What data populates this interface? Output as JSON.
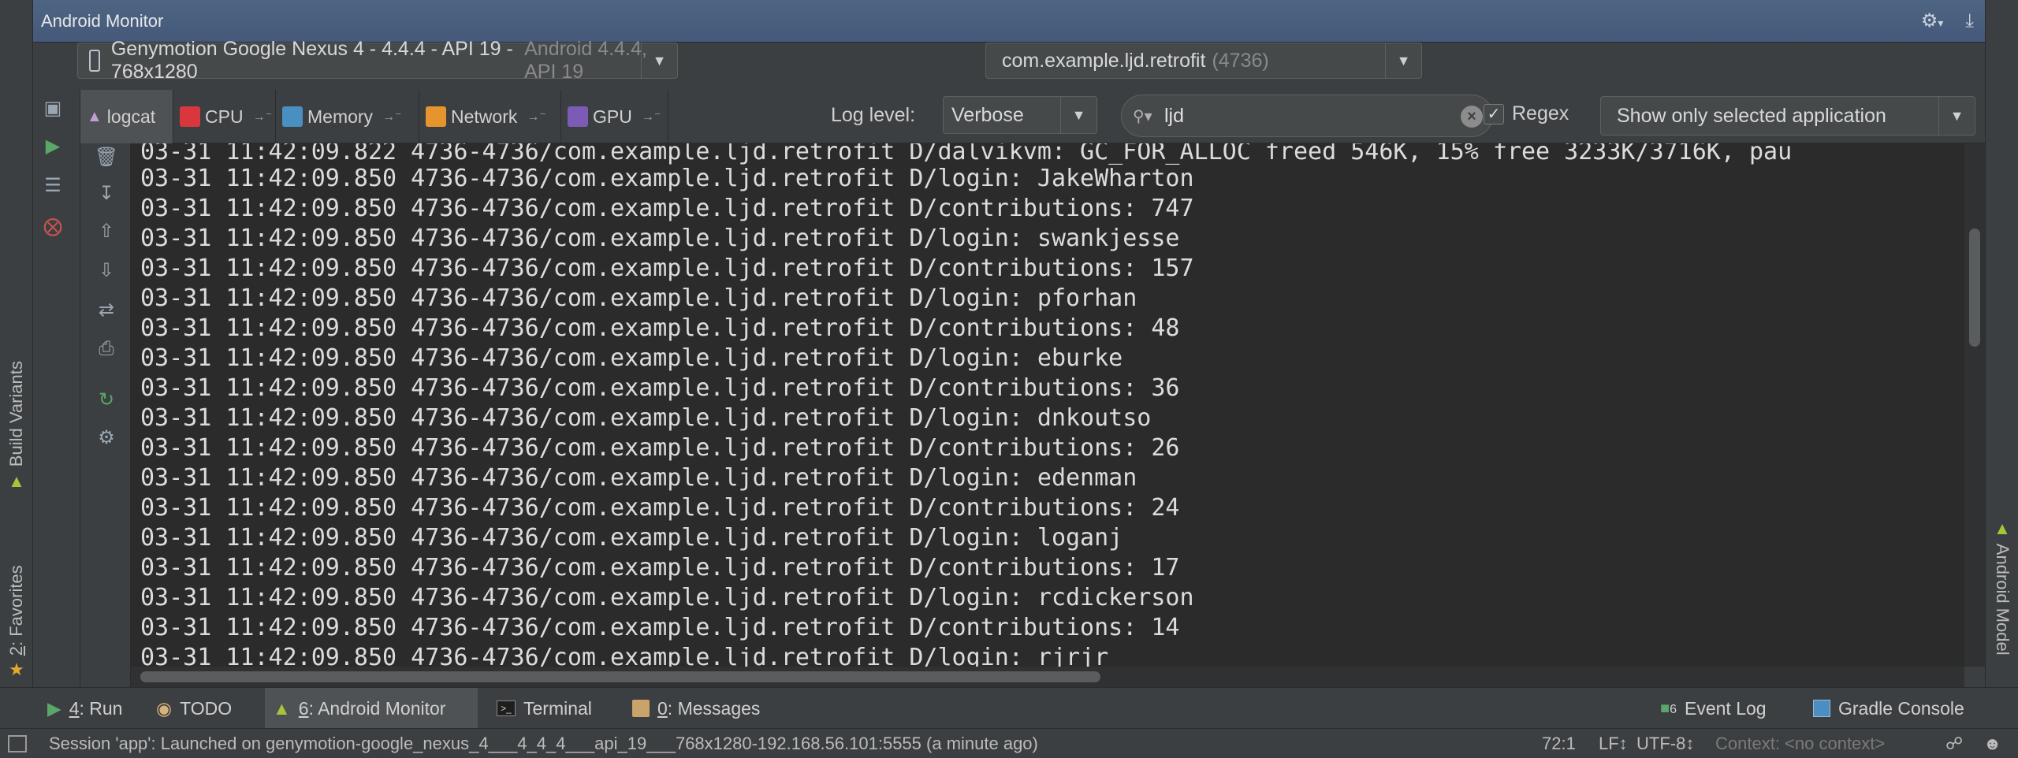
{
  "window": {
    "title": "Android Monitor"
  },
  "side_tabs": {
    "build_variants": "Build Variants",
    "favorites_num": "2",
    "favorites_label": ": Favorites",
    "android_model": "Android Model"
  },
  "device_selector": {
    "name": "Genymotion Google Nexus 4 - 4.4.4 - API 19 - 768x1280",
    "detail": "Android 4.4.4, API 19"
  },
  "process_selector": {
    "name": "com.example.ljd.retrofit",
    "pid": "(4736)"
  },
  "tabs": [
    {
      "label": "logcat",
      "color": "#c0a0d0"
    },
    {
      "label": "CPU",
      "color": "#d9363e"
    },
    {
      "label": "Memory",
      "color": "#4a8fc2"
    },
    {
      "label": "Network",
      "color": "#e6952e"
    },
    {
      "label": "GPU",
      "color": "#7b5bb5"
    }
  ],
  "filters": {
    "log_level_label": "Log level:",
    "log_level_value": "Verbose",
    "search_value": "ljd",
    "regex_label": "Regex",
    "regex_checked": true,
    "app_filter": "Show only selected application"
  },
  "log_lines": [
    "03-31 11:42:09.822 4736-4736/com.example.ljd.retrofit D/dalvikvm: GC_FOR_ALLOC freed 546K, 15% free 3233K/3716K, pau",
    "03-31 11:42:09.850 4736-4736/com.example.ljd.retrofit D/login: JakeWharton",
    "03-31 11:42:09.850 4736-4736/com.example.ljd.retrofit D/contributions: 747",
    "03-31 11:42:09.850 4736-4736/com.example.ljd.retrofit D/login: swankjesse",
    "03-31 11:42:09.850 4736-4736/com.example.ljd.retrofit D/contributions: 157",
    "03-31 11:42:09.850 4736-4736/com.example.ljd.retrofit D/login: pforhan",
    "03-31 11:42:09.850 4736-4736/com.example.ljd.retrofit D/contributions: 48",
    "03-31 11:42:09.850 4736-4736/com.example.ljd.retrofit D/login: eburke",
    "03-31 11:42:09.850 4736-4736/com.example.ljd.retrofit D/contributions: 36",
    "03-31 11:42:09.850 4736-4736/com.example.ljd.retrofit D/login: dnkoutso",
    "03-31 11:42:09.850 4736-4736/com.example.ljd.retrofit D/contributions: 26",
    "03-31 11:42:09.850 4736-4736/com.example.ljd.retrofit D/login: edenman",
    "03-31 11:42:09.850 4736-4736/com.example.ljd.retrofit D/contributions: 24",
    "03-31 11:42:09.850 4736-4736/com.example.ljd.retrofit D/login: loganj",
    "03-31 11:42:09.850 4736-4736/com.example.ljd.retrofit D/contributions: 17",
    "03-31 11:42:09.850 4736-4736/com.example.ljd.retrofit D/login: rcdickerson",
    "03-31 11:42:09.850 4736-4736/com.example.ljd.retrofit D/contributions: 14",
    "03-31 11:42:09.850 4736-4736/com.example.ljd.retrofit D/login: rjrjr"
  ],
  "bottom_tabs": {
    "run_num": "4",
    "run_label": ": Run",
    "todo_label": "TODO",
    "monitor_num": "6",
    "monitor_label": ": Android Monitor",
    "terminal_label": "Terminal",
    "messages_num": "0",
    "messages_label": ": Messages",
    "event_log_count": "6",
    "event_log_label": "Event Log",
    "gradle_label": "Gradle Console"
  },
  "status": {
    "message": "Session 'app': Launched on genymotion-google_nexus_4___4_4_4___api_19___768x1280-192.168.56.101:5555 (a minute ago)",
    "position": "72:1",
    "line_sep": "LF↕",
    "encoding": "UTF-8↕",
    "context": "Context: <no context>"
  },
  "colors": {
    "header_bg": "#4d6582",
    "panel_bg": "#3c3f41",
    "editor_bg": "#2b2b2b",
    "run_green": "#59a869",
    "error_red": "#c75450"
  }
}
